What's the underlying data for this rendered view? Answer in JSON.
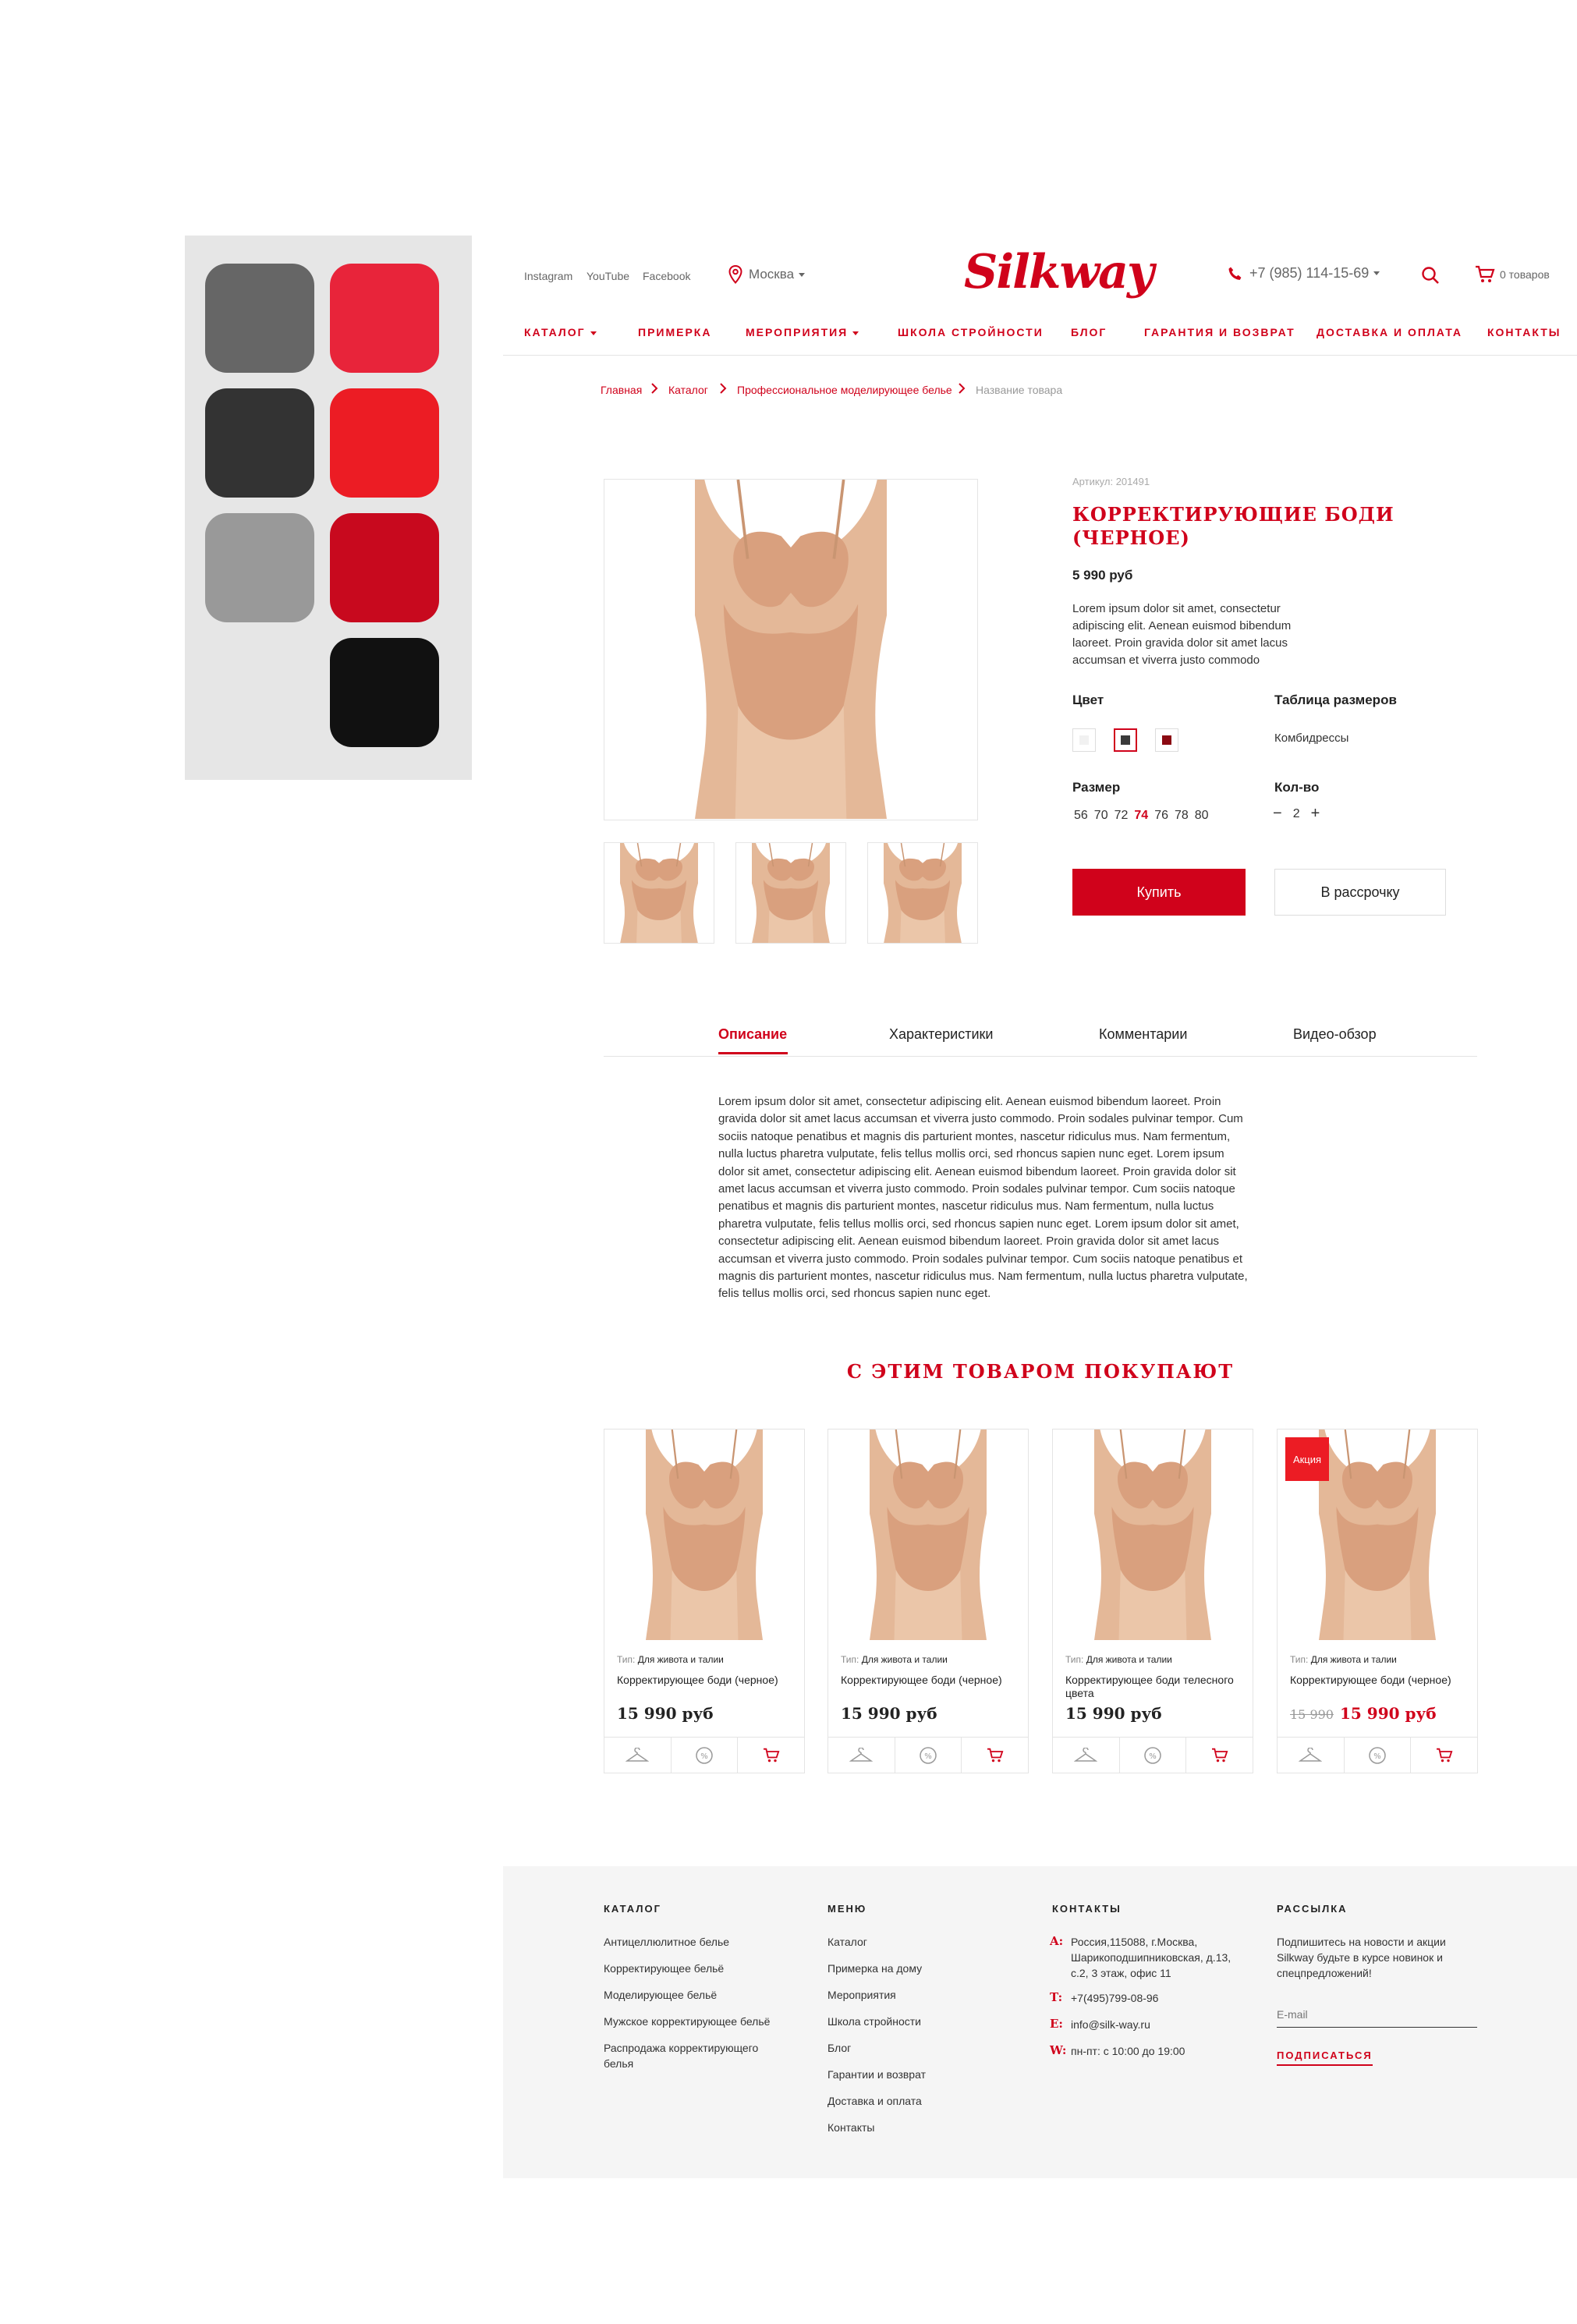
{
  "palette": {
    "colors": [
      "#666666",
      "#e8243a",
      "#333333",
      "#ec1c24",
      "#999999",
      "#c8091e",
      "#111111"
    ]
  },
  "header": {
    "social": [
      "Instagram",
      "YouTube",
      "Facebook"
    ],
    "city": "Москва",
    "logo": "Silkway",
    "phone": "+7 (985) 114-15-69",
    "cart": "0 товаров",
    "nav": [
      "КАТАЛОГ",
      "ПРИМЕРКА",
      "МЕРОПРИЯТИЯ",
      "ШКОЛА СТРОЙНОСТИ",
      "БЛОГ",
      "ГАРАНТИЯ И ВОЗВРАТ",
      "ДОСТАВКА И ОПЛАТА",
      "КОНТАКТЫ"
    ]
  },
  "breadcrumb": [
    "Главная",
    "Каталог",
    "Профессиональное моделирующее белье",
    "Название товара"
  ],
  "product": {
    "sku": "Артикул: 201491",
    "title_line1": "КОРРЕКТИРУЮЩИЕ БОДИ",
    "title_line2": "(ЧЕРНОЕ)",
    "price": "5 990 руб",
    "desc_lines": [
      "Lorem ipsum dolor sit amet, consectetur",
      "adipiscing elit. Aenean euismod bibendum",
      "laoreet. Proin gravida dolor sit amet lacus",
      "accumsan et viverra justo commodo"
    ],
    "color_label": "Цвет",
    "colors": [
      "#f1f1f1",
      "#3a3a3a",
      "#8b0a12"
    ],
    "size_table_label": "Таблица размеров",
    "size_table_value": "Комбидрессы",
    "size_label": "Размер",
    "sizes": [
      "56",
      "70",
      "72",
      "74",
      "76",
      "78",
      "80"
    ],
    "selected_size": "74",
    "qty_label": "Кол-во",
    "qty_minus": "−",
    "qty_value": "2",
    "qty_plus": "+",
    "buy": "Купить",
    "installment": "В рассрочку"
  },
  "tabs": [
    "Описание",
    "Характеристики",
    "Комментарии",
    "Видео-обзор"
  ],
  "description_lines": [
    "Lorem ipsum dolor sit amet, consectetur adipiscing elit. Aenean euismod bibendum laoreet. Proin",
    "gravida dolor sit amet lacus accumsan et viverra justo commodo. Proin sodales pulvinar tempor. Cum",
    "sociis natoque penatibus et magnis dis parturient montes, nascetur ridiculus mus. Nam fermentum,",
    "nulla luctus pharetra vulputate, felis tellus mollis orci, sed rhoncus sapien nunc eget. Lorem ipsum",
    "dolor sit amet, consectetur adipiscing elit. Aenean euismod bibendum laoreet. Proin gravida dolor sit",
    "amet lacus accumsan et viverra justo commodo. Proin sodales pulvinar tempor. Cum sociis natoque",
    "penatibus et magnis dis parturient montes, nascetur ridiculus mus. Nam fermentum, nulla luctus",
    "pharetra vulputate, felis tellus mollis orci, sed rhoncus sapien nunc eget. Lorem ipsum dolor sit amet,",
    "consectetur adipiscing elit. Aenean euismod bibendum laoreet. Proin gravida dolor sit amet lacus",
    "accumsan et viverra justo commodo. Proin sodales pulvinar tempor. Cum sociis natoque penatibus et",
    "magnis dis parturient montes, nascetur ridiculus mus. Nam fermentum, nulla luctus pharetra vulputate,",
    "felis tellus mollis orci, sed rhoncus sapien nunc eget."
  ],
  "related": {
    "heading": "С ЭТИМ ТОВАРОМ ПОКУПАЮТ",
    "type_prefix": "Тип:",
    "cards": [
      {
        "type": "Для живота и талии",
        "title": "Корректирующее боди (черное)",
        "old_price": "",
        "price": "15 990 руб",
        "badge": ""
      },
      {
        "type": "Для живота и талии",
        "title": "Корректирующее боди (черное)",
        "old_price": "",
        "price": "15 990 руб",
        "badge": ""
      },
      {
        "type": "Для живота и талии",
        "title": "Корректирующее боди телесного цвета",
        "old_price": "",
        "price": "15 990 руб",
        "badge": ""
      },
      {
        "type": "Для живота и талии",
        "title": "Корректирующее боди (черное)",
        "old_price": "15 990",
        "price": "15 990 руб",
        "badge": "Акция"
      }
    ]
  },
  "footer": {
    "catalog_heading": "КАТАЛОГ",
    "catalog": [
      "Антицеллюлитное белье",
      "Корректирующее бельё",
      "Моделирующее бельё",
      "Мужское корректирующее бельё",
      "Распродажа корректирующего",
      "белья"
    ],
    "menu_heading": "МЕНЮ",
    "menu": [
      "Каталог",
      "Примерка на дому",
      "Мероприятия",
      "Школа стройности",
      "Блог",
      "Гарантии и возврат",
      "Доставка и оплата",
      "Контакты"
    ],
    "contacts_heading": "КОНТАКТЫ",
    "address_label": "A:",
    "address_lines": [
      "Россия,115088, г.Москва,",
      "Шарикоподшипниковская, д.13,",
      "с.2, 3 этаж, офис 11"
    ],
    "phone_label": "T:",
    "phone": "+7(495)799-08-96",
    "email_label": "E:",
    "email": "info@silk-way.ru",
    "hours_label": "W:",
    "hours": "пн-пт: с 10:00 до 19:00",
    "newsletter_heading": "РАССЫЛКА",
    "newsletter_lines": [
      "Подпишитесь на новости и акции",
      "Silkway будьте в курсе новинок и",
      "спецпредложений!"
    ],
    "email_placeholder": "E-mail",
    "subscribe": "ПОДПИСАТЬСЯ"
  }
}
